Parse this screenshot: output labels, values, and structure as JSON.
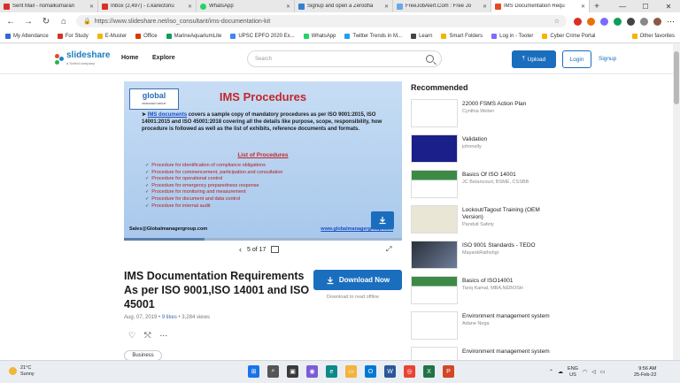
{
  "browser": {
    "tabs": [
      {
        "label": "Sent Mail - nomalkumaran",
        "color": "#d93025"
      },
      {
        "label": "Inbox (2,497) - c.karectonu",
        "color": "#d93025"
      },
      {
        "label": "WhatsApp",
        "color": "#25d366"
      },
      {
        "label": "Signup and open a Zerodha",
        "color": "#387ed1"
      },
      {
        "label": "FreeJobAlert.Com : Free Jo",
        "color": "#6aa7e8"
      },
      {
        "label": "IMS Documentation Requ",
        "color": "#e34b26",
        "active": true
      }
    ],
    "new_tab": "+",
    "url": "https://www.slideshare.net/iso_consultant/ims-documentation-kit",
    "bookmarks": [
      {
        "label": "My Attendance",
        "color": "#3367d6"
      },
      {
        "label": "For Study",
        "color": "#d93025"
      },
      {
        "label": "E-Muster",
        "color": "#f4b400"
      },
      {
        "label": "Office",
        "color": "#d83b01"
      },
      {
        "label": "MarineAquariumLite",
        "color": "#0f9d58"
      },
      {
        "label": "UPSC EPFO 2020 Ex...",
        "color": "#4285f4"
      },
      {
        "label": "WhatsApp",
        "color": "#25d366"
      },
      {
        "label": "Twitter Trends in M...",
        "color": "#1da1f2"
      },
      {
        "label": "Learn",
        "color": "#444444"
      },
      {
        "label": "Smart Folders",
        "color": "#f4b400"
      },
      {
        "label": "Log in - Tooter",
        "color": "#7b6cff"
      },
      {
        "label": "Cyber Crime Portal",
        "color": "#f4b400"
      }
    ],
    "other_favorites": "Other favorites"
  },
  "header": {
    "logo_text": "slideshare",
    "logo_sub": "a Scribd company",
    "home": "Home",
    "explore": "Explore",
    "search_placeholder": "Search",
    "upload": "Upload",
    "login": "Login",
    "signup": "Signup"
  },
  "slide": {
    "logo_main": "global",
    "logo_sub": "MANAGER GROUP",
    "title": "IMS Procedures",
    "body_link": "IMS documents",
    "body": " covers a sample copy of mandatory procedures as per ISO 9001:2015, ISO 14001:2015 and ISO 45001:2018 covering all the details like purpose, scope, responsibility, how procedure is followed as well as the list of exhibits, reference documents and formats.",
    "list_title": "List of Procedures",
    "list": [
      "Procedure for identification of compliance obligations",
      "Procedure for commencement, participation and consultation",
      "Procedure for operational control",
      "Procedure for emergency preparedness response",
      "Procedure for monitoring and measurement",
      "Procedure for document and data control",
      "Procedure for internal audit"
    ],
    "footer_left": "Sales@Globalmanagergroup.com",
    "footer_right": "www.globalmanagergroup.com",
    "progress": 0.29,
    "page_current": "5",
    "page_total": "17",
    "page_label": "5 of 17"
  },
  "document": {
    "title": "IMS Documentation Requirements As per ISO 9001,ISO 14001 and ISO 45001",
    "date": "Aug. 07, 2019",
    "likes": "9 likes",
    "views": "3,284 views",
    "tag": "Business",
    "download": "Download Now",
    "download_sub": "Download to read offline"
  },
  "recommended": {
    "title": "Recommended",
    "items": [
      {
        "name": "22000 FSMS Action Plan",
        "author": "Cynthia Weber",
        "thumb": "#ffffff"
      },
      {
        "name": "Validation",
        "author": "johnnelly",
        "thumb": "#1b1f8a"
      },
      {
        "name": "Basics Of ISO 14001",
        "author": "JC Betancourt, BSME, CSSBB",
        "thumb": "#3c8a46"
      },
      {
        "name": "Lockout/Tagout Training (OEM Version)",
        "author": "Panduit Safety",
        "thumb": "#e9e6d6"
      },
      {
        "name": "ISO 9001 Standards - TEDO",
        "author": "MayankRathshgi",
        "thumb": "#2a2f3a"
      },
      {
        "name": "Basics of ISO14001",
        "author": "Tariq Kamal, MBA,NEBOSH",
        "thumb": "#3c8a46"
      },
      {
        "name": "Environment management system",
        "author": "Adane Nega",
        "thumb": "#ffffff"
      },
      {
        "name": "Environment management system",
        "author": "",
        "thumb": "#ffffff"
      }
    ]
  },
  "taskbar": {
    "temp": "21°C",
    "weather": "Sunny",
    "lang_1": "ENG",
    "lang_2": "US",
    "time": "9:56 AM",
    "date": "25-Feb-22"
  },
  "colors": {
    "brand_blue": "#1a6ebd",
    "slide_title_red": "#c3272b"
  }
}
